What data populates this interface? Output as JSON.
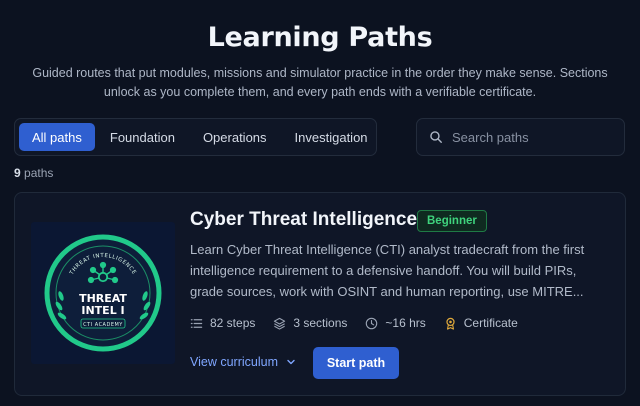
{
  "header": {
    "title": "Learning Paths",
    "subtitle": "Guided routes that put modules, missions and simulator practice in the order they make sense. Sections unlock as you complete them, and every path ends with a verifiable certificate."
  },
  "filters": {
    "tabs": [
      {
        "label": "All paths",
        "active": true
      },
      {
        "label": "Foundation",
        "active": false
      },
      {
        "label": "Operations",
        "active": false
      },
      {
        "label": "Investigation",
        "active": false
      }
    ]
  },
  "search": {
    "placeholder": "Search paths",
    "value": ""
  },
  "results": {
    "count": "9",
    "suffix": "paths"
  },
  "path_card": {
    "title": "Cyber Threat Intelligence",
    "level": "Beginner",
    "description": "Learn Cyber Threat Intelligence (CTI) analyst tradecraft from the first intelligence requirement to a defensive handoff. You will build PIRs, grade sources, work with OSINT and human reporting, use MITRE...",
    "badge_image": {
      "ring_text": "THREAT INTELLIGENCE",
      "line1": "THREAT",
      "line2": "INTEL I",
      "footer": "CTI ACADEMY"
    },
    "meta": {
      "steps": "82 steps",
      "sections": "3 sections",
      "duration": "~16 hrs",
      "certificate": "Certificate"
    },
    "view_curriculum_label": "View curriculum",
    "start_label": "Start path"
  },
  "colors": {
    "background": "#0c1220",
    "accent": "#2f5fd0",
    "badge_green": "#3fd37d",
    "link": "#7fa6ff",
    "emblem_green": "#21c98a"
  },
  "icons": {
    "search": "search-icon",
    "steps": "list-icon",
    "sections": "layers-icon",
    "duration": "clock-icon",
    "certificate": "award-icon",
    "expand": "chevron-down-icon"
  }
}
